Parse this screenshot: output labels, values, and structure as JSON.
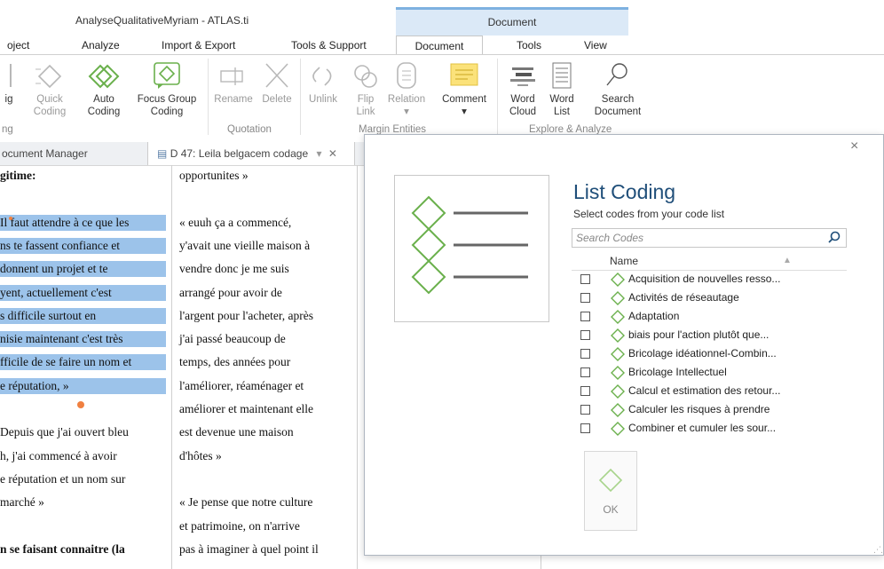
{
  "window": {
    "title": "AnalyseQualitativeMyriam - ATLAS.ti",
    "context_group": "Document"
  },
  "menu": [
    "oject",
    "Analyze",
    "Import & Export",
    "Tools & Support",
    "Document",
    "Tools",
    "View"
  ],
  "ribbon": {
    "buttons": {
      "cut_off": "ig",
      "quick_coding": [
        "Quick",
        "Coding"
      ],
      "auto_coding": [
        "Auto",
        "Coding"
      ],
      "focus_group": [
        "Focus Group",
        "Coding"
      ],
      "rename": "Rename",
      "delete": "Delete",
      "unlink": "Unlink",
      "flip_link": [
        "Flip",
        "Link"
      ],
      "relation": "Relation",
      "comment": "Comment",
      "word_cloud": [
        "Word",
        "Cloud"
      ],
      "word_list": [
        "Word",
        "List"
      ],
      "search_document": [
        "Search",
        "Document"
      ]
    },
    "groups": {
      "left": "ng",
      "quotation": "Quotation",
      "margin": "Margin Entities",
      "explore": "Explore & Analyze"
    }
  },
  "doc_tabs": {
    "manager": "ocument Manager",
    "active": "D 47: Leila belgacem codage"
  },
  "doc": {
    "left_col": [
      {
        "t": "gitime:",
        "b": true
      },
      {
        "t": "",
        "b": false
      },
      {
        "t": "Il faut attendre à ce que les",
        "h": true
      },
      {
        "t": "ns te fassent confiance et",
        "h": true
      },
      {
        "t": "donnent un projet et te",
        "h": true
      },
      {
        "t": "yent, actuellement c'est",
        "h": true
      },
      {
        "t": "s difficile surtout en",
        "h": true
      },
      {
        "t": "nisie maintenant c'est très",
        "h": true
      },
      {
        "t": "fficile de se faire un nom et",
        "h": true
      },
      {
        "t": "e réputation, »",
        "h": true
      },
      {
        "t": ""
      },
      {
        "t": "Depuis que j'ai ouvert bleu"
      },
      {
        "t": "h, j'ai commencé à avoir"
      },
      {
        "t": "e réputation et un nom sur"
      },
      {
        "t": "marché »"
      },
      {
        "t": ""
      },
      {
        "t": "n se faisant connaitre (la",
        "b": true
      }
    ],
    "right_col": [
      "opportunites »",
      "",
      "« euuh ça a commencé,",
      "y'avait une vieille maison à",
      "vendre donc je me suis",
      "arrangé pour avoir de",
      "l'argent pour l'acheter, après",
      "j'ai passé beaucoup de",
      "temps, des années pour",
      "l'améliorer, réaménager et",
      "améliorer et maintenant elle",
      "est devenue une maison",
      "d'hôtes »",
      "",
      "« Je pense que notre culture",
      "et patrimoine, on n'arrive",
      "pas à imaginer à quel point il"
    ]
  },
  "dialog": {
    "title": "List Coding",
    "subtitle": "Select codes from your code list",
    "search_placeholder": "Search Codes",
    "column": "Name",
    "codes": [
      "Acquisition de nouvelles resso...",
      "Activités de réseautage",
      "Adaptation",
      "biais pour l'action plutôt que...",
      "Bricolage idéationnel-Combin...",
      "Bricolage Intellectuel",
      "Calcul et estimation des retour...",
      "Calculer les risques à prendre",
      "Combiner et cumuler les sour..."
    ],
    "ok": "OK",
    "close": "×"
  },
  "colors": {
    "accent": "#1f4e79",
    "highlight": "#9cc3ea",
    "code_icon": "#6ab04c"
  }
}
